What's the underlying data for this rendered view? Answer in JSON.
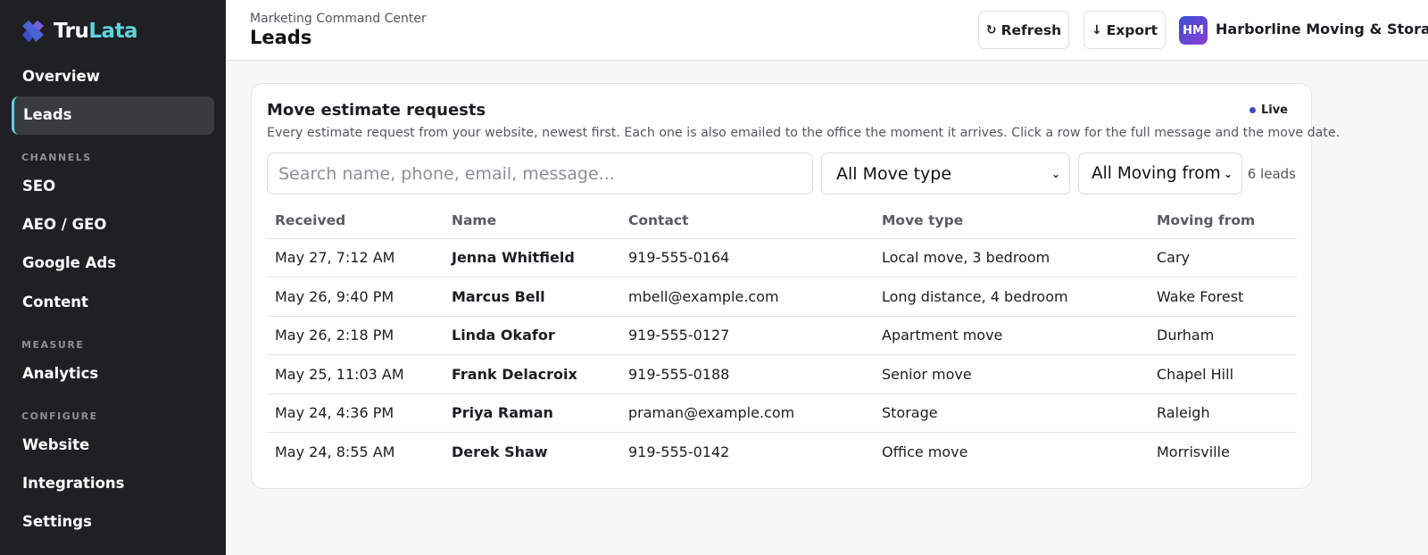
{
  "brand": {
    "name_part1": "Tru",
    "name_part2": "Lata",
    "accent": "#5fd3de"
  },
  "sidebar": {
    "items": [
      {
        "label": "Overview"
      },
      {
        "label": "Leads",
        "active": true
      },
      {
        "label": "SEO"
      },
      {
        "label": "AEO / GEO"
      },
      {
        "label": "Google Ads"
      },
      {
        "label": "Content"
      },
      {
        "label": "Analytics"
      },
      {
        "label": "Website"
      },
      {
        "label": "Integrations"
      },
      {
        "label": "Settings"
      }
    ],
    "sections": {
      "channels": "CHANNELS",
      "measure": "MEASURE",
      "configure": "CONFIGURE"
    }
  },
  "header": {
    "breadcrumb": "Marketing Command Center",
    "title": "Leads",
    "refresh_label": "Refresh",
    "export_label": "Export",
    "org_initials": "HM",
    "org_name": "Harborline Moving & Storage"
  },
  "card": {
    "title": "Move estimate requests",
    "live_label": "Live",
    "description": "Every estimate request from your website, newest first. Each one is also emailed to the office the moment it arrives. Click a row for the full message and the move date.",
    "search_placeholder": "Search name, phone, email, message...",
    "move_type_filter": "All Move type",
    "moving_from_filter": "All Moving from",
    "lead_count": "6 leads"
  },
  "table": {
    "columns": [
      "Received",
      "Name",
      "Contact",
      "Move type",
      "Moving from"
    ],
    "rows": [
      [
        "May 27, 7:12 AM",
        "Jenna Whitfield",
        "919-555-0164",
        "Local move, 3 bedroom",
        "Cary"
      ],
      [
        "May 26, 9:40 PM",
        "Marcus Bell",
        "mbell@example.com",
        "Long distance, 4 bedroom",
        "Wake Forest"
      ],
      [
        "May 26, 2:18 PM",
        "Linda Okafor",
        "919-555-0127",
        "Apartment move",
        "Durham"
      ],
      [
        "May 25, 11:03 AM",
        "Frank Delacroix",
        "919-555-0188",
        "Senior move",
        "Chapel Hill"
      ],
      [
        "May 24, 4:36 PM",
        "Priya Raman",
        "praman@example.com",
        "Storage",
        "Raleigh"
      ],
      [
        "May 24, 8:55 AM",
        "Derek Shaw",
        "919-555-0142",
        "Office move",
        "Morrisville"
      ]
    ]
  },
  "colors": {
    "sidebar_bg": "#1f2023",
    "active_item_bg": "#3a3b3f",
    "live_dot": "#3a4cc2"
  }
}
